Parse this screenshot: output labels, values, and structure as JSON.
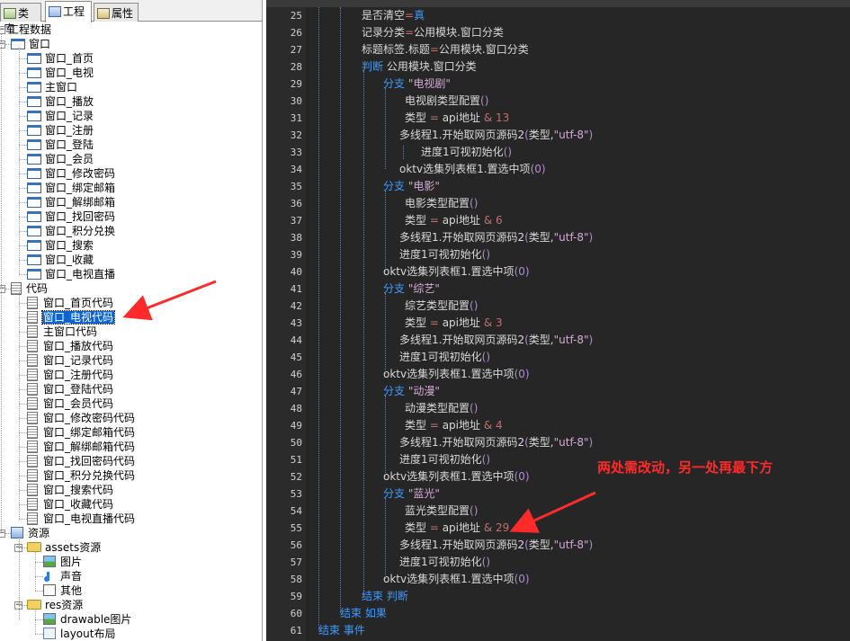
{
  "left_panel": {
    "tabs": [
      {
        "label": "类库",
        "icon": "library-icon"
      },
      {
        "label": "工程",
        "icon": "project-icon",
        "active": true
      },
      {
        "label": "属性",
        "icon": "properties-icon"
      }
    ],
    "tree": {
      "root_label": "工程数据",
      "windows_group": "窗口",
      "windows": [
        "窗口_首页",
        "窗口_电视",
        "主窗口",
        "窗口_播放",
        "窗口_记录",
        "窗口_注册",
        "窗口_登陆",
        "窗口_会员",
        "窗口_修改密码",
        "窗口_绑定邮箱",
        "窗口_解绑邮箱",
        "窗口_找回密码",
        "窗口_积分兑换",
        "窗口_搜索",
        "窗口_收藏",
        "窗口_电视直播"
      ],
      "code_group": "代码",
      "codes": [
        "窗口_首页代码",
        "窗口_电视代码",
        "主窗口代码",
        "窗口_播放代码",
        "窗口_记录代码",
        "窗口_注册代码",
        "窗口_登陆代码",
        "窗口_会员代码",
        "窗口_修改密码代码",
        "窗口_绑定邮箱代码",
        "窗口_解绑邮箱代码",
        "窗口_找回密码代码",
        "窗口_积分兑换代码",
        "窗口_搜索代码",
        "窗口_收藏代码",
        "窗口_电视直播代码"
      ],
      "selected_code": "窗口_电视代码",
      "resources_group": "资源",
      "assets_folder": "assets资源",
      "assets_items": [
        "图片",
        "声音",
        "其他"
      ],
      "res_folder": "res资源",
      "res_items": [
        "drawable图片",
        "layout布局"
      ]
    }
  },
  "editor": {
    "lines": [
      {
        "n": "25",
        "indent": 1,
        "parts": [
          [
            "t",
            "是否清空"
          ],
          [
            "o",
            "="
          ],
          [
            "k",
            "真"
          ]
        ]
      },
      {
        "n": "26",
        "indent": 1,
        "parts": [
          [
            "t",
            "记录分类"
          ],
          [
            "o",
            "="
          ],
          [
            "t",
            "公用模块.窗口分类"
          ]
        ]
      },
      {
        "n": "27",
        "indent": 1,
        "parts": [
          [
            "t",
            "标题标签.标题"
          ],
          [
            "o",
            "="
          ],
          [
            "t",
            "公用模块.窗口分类"
          ]
        ]
      },
      {
        "n": "28",
        "indent": 1,
        "parts": [
          [
            "k",
            "判断 "
          ],
          [
            "t",
            "公用模块.窗口分类"
          ]
        ]
      },
      {
        "n": "29",
        "indent": 2,
        "parts": [
          [
            "k",
            "分支 "
          ],
          [
            "s",
            "\"电视剧\""
          ]
        ]
      },
      {
        "n": "30",
        "indent": 3,
        "parts": [
          [
            "t",
            "电视剧类型配置"
          ],
          [
            "p",
            "()"
          ]
        ]
      },
      {
        "n": "31",
        "indent": 3,
        "parts": [
          [
            "t",
            "类型 "
          ],
          [
            "o",
            "= "
          ],
          [
            "t",
            "api地址 "
          ],
          [
            "o",
            "& 13"
          ]
        ]
      },
      {
        "n": "32",
        "indent": 2.75,
        "parts": [
          [
            "t",
            "多线程1.开始取网页源码2"
          ],
          [
            "p",
            "("
          ],
          [
            "t",
            "类型,"
          ],
          [
            "s",
            "\"utf-8\""
          ],
          [
            "p",
            ")"
          ]
        ]
      },
      {
        "n": "33",
        "indent": 3.75,
        "parts": [
          [
            "t",
            "进度1可视初始化"
          ],
          [
            "p",
            "()"
          ]
        ]
      },
      {
        "n": "34",
        "indent": 2.75,
        "parts": [
          [
            "t",
            "oktv选集列表框1.置选中项"
          ],
          [
            "p",
            "(0)"
          ]
        ]
      },
      {
        "n": "35",
        "indent": 2,
        "parts": [
          [
            "k",
            "分支 "
          ],
          [
            "s",
            "\"电影\""
          ]
        ]
      },
      {
        "n": "36",
        "indent": 3,
        "parts": [
          [
            "t",
            "电影类型配置"
          ],
          [
            "p",
            "()"
          ]
        ]
      },
      {
        "n": "37",
        "indent": 3,
        "parts": [
          [
            "t",
            "类型 "
          ],
          [
            "o",
            "= "
          ],
          [
            "t",
            "api地址 "
          ],
          [
            "o",
            "& 6"
          ]
        ]
      },
      {
        "n": "38",
        "indent": 2.75,
        "parts": [
          [
            "t",
            "多线程1.开始取网页源码2"
          ],
          [
            "p",
            "("
          ],
          [
            "t",
            "类型,"
          ],
          [
            "s",
            "\"utf-8\""
          ],
          [
            "p",
            ")"
          ]
        ]
      },
      {
        "n": "39",
        "indent": 2.75,
        "parts": [
          [
            "t",
            "进度1可视初始化"
          ],
          [
            "p",
            "()"
          ]
        ]
      },
      {
        "n": "40",
        "indent": 2,
        "parts": [
          [
            "t",
            "oktv选集列表框1.置选中项"
          ],
          [
            "p",
            "(0)"
          ]
        ]
      },
      {
        "n": "41",
        "indent": 2,
        "parts": [
          [
            "k",
            "分支 "
          ],
          [
            "s",
            "\"综艺\""
          ]
        ]
      },
      {
        "n": "42",
        "indent": 3,
        "parts": [
          [
            "t",
            "综艺类型配置"
          ],
          [
            "p",
            "()"
          ]
        ]
      },
      {
        "n": "43",
        "indent": 3,
        "parts": [
          [
            "t",
            "类型 "
          ],
          [
            "o",
            "= "
          ],
          [
            "t",
            "api地址 "
          ],
          [
            "o",
            "& 3"
          ]
        ]
      },
      {
        "n": "44",
        "indent": 2.75,
        "parts": [
          [
            "t",
            "多线程1.开始取网页源码2"
          ],
          [
            "p",
            "("
          ],
          [
            "t",
            "类型,"
          ],
          [
            "s",
            "\"utf-8\""
          ],
          [
            "p",
            ")"
          ]
        ]
      },
      {
        "n": "45",
        "indent": 2.75,
        "parts": [
          [
            "t",
            "进度1可视初始化"
          ],
          [
            "p",
            "()"
          ]
        ]
      },
      {
        "n": "46",
        "indent": 2,
        "parts": [
          [
            "t",
            "oktv选集列表框1.置选中项"
          ],
          [
            "p",
            "(0)"
          ]
        ]
      },
      {
        "n": "47",
        "indent": 2,
        "parts": [
          [
            "k",
            "分支 "
          ],
          [
            "s",
            "\"动漫\""
          ]
        ]
      },
      {
        "n": "48",
        "indent": 3,
        "parts": [
          [
            "t",
            "动漫类型配置"
          ],
          [
            "p",
            "()"
          ]
        ]
      },
      {
        "n": "49",
        "indent": 3,
        "parts": [
          [
            "t",
            "类型 "
          ],
          [
            "o",
            "= "
          ],
          [
            "t",
            "api地址 "
          ],
          [
            "o",
            "& 4"
          ]
        ]
      },
      {
        "n": "50",
        "indent": 2.75,
        "parts": [
          [
            "t",
            "多线程1.开始取网页源码2"
          ],
          [
            "p",
            "("
          ],
          [
            "t",
            "类型,"
          ],
          [
            "s",
            "\"utf-8\""
          ],
          [
            "p",
            ")"
          ]
        ]
      },
      {
        "n": "51",
        "indent": 2.75,
        "parts": [
          [
            "t",
            "进度1可视初始化"
          ],
          [
            "p",
            "()"
          ]
        ]
      },
      {
        "n": "52",
        "indent": 2,
        "parts": [
          [
            "t",
            "oktv选集列表框1.置选中项"
          ],
          [
            "p",
            "(0)"
          ]
        ]
      },
      {
        "n": "53",
        "indent": 2,
        "parts": [
          [
            "k",
            "分支 "
          ],
          [
            "s",
            "\"蓝光\""
          ]
        ]
      },
      {
        "n": "54",
        "indent": 3,
        "parts": [
          [
            "t",
            "蓝光类型配置"
          ],
          [
            "p",
            "()"
          ]
        ]
      },
      {
        "n": "55",
        "indent": 3,
        "parts": [
          [
            "t",
            "类型 "
          ],
          [
            "o",
            "= "
          ],
          [
            "t",
            "api地址 "
          ],
          [
            "o",
            "& 29"
          ]
        ]
      },
      {
        "n": "56",
        "indent": 2.75,
        "parts": [
          [
            "t",
            "多线程1.开始取网页源码2"
          ],
          [
            "p",
            "("
          ],
          [
            "t",
            "类型,"
          ],
          [
            "s",
            "\"utf-8\""
          ],
          [
            "p",
            ")"
          ]
        ]
      },
      {
        "n": "57",
        "indent": 2.75,
        "parts": [
          [
            "t",
            "进度1可视初始化"
          ],
          [
            "p",
            "()"
          ]
        ]
      },
      {
        "n": "58",
        "indent": 2,
        "parts": [
          [
            "t",
            "oktv选集列表框1.置选中项"
          ],
          [
            "p",
            "(0)"
          ]
        ]
      },
      {
        "n": "59",
        "indent": 1,
        "parts": [
          [
            "k",
            "结束 判断"
          ]
        ]
      },
      {
        "n": "60",
        "indent": 0,
        "parts": [
          [
            "k",
            "结束 如果"
          ]
        ]
      },
      {
        "n": "61",
        "indent": -1,
        "parts": [
          [
            "k",
            "结束 事件"
          ]
        ]
      }
    ]
  },
  "annotation": {
    "text": "两处需改动，另一处再最下方",
    "color": "#ff2a2a"
  }
}
